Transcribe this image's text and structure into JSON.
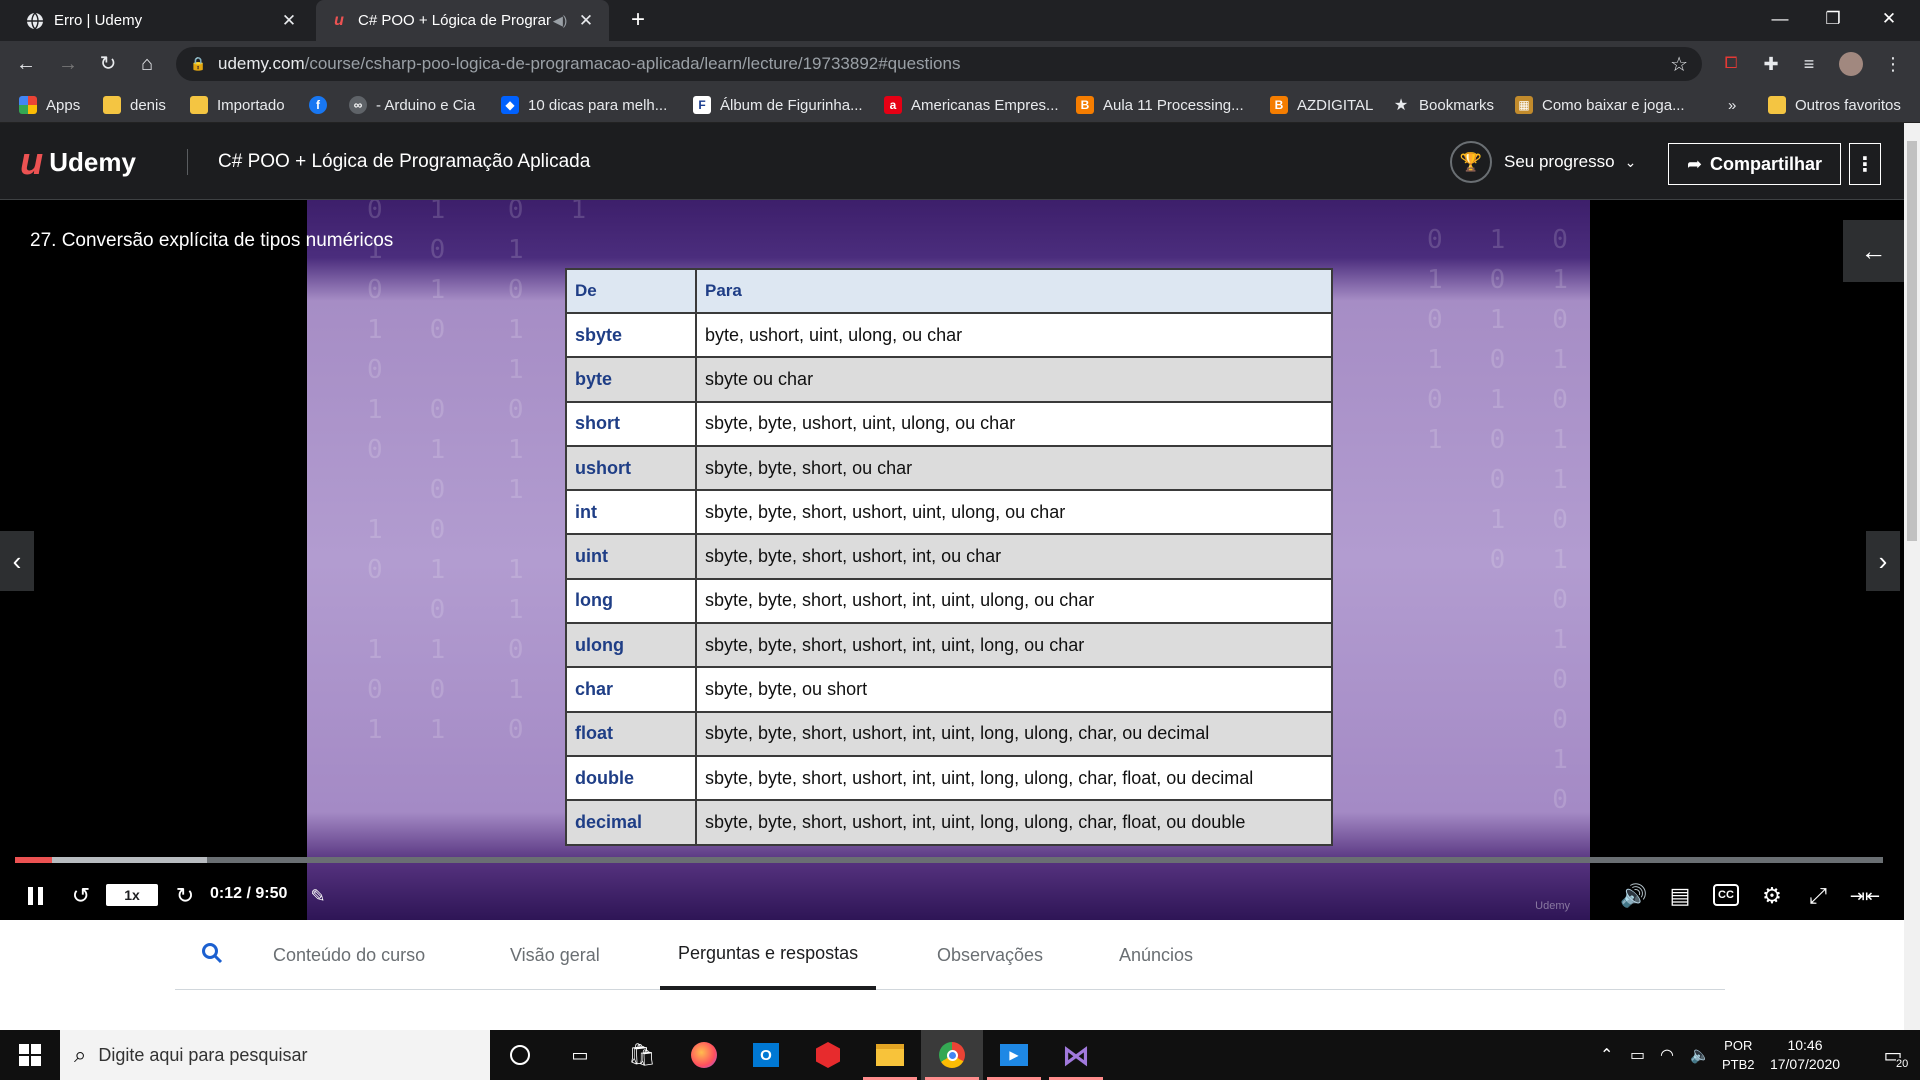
{
  "browser": {
    "tabs": [
      {
        "title": "Erro | Udemy",
        "icon": "globe-icon"
      },
      {
        "title": "C# POO + Lógica de Progran",
        "icon": "udemy-icon"
      }
    ],
    "url_host": "udemy.com",
    "url_path": "/course/csharp-poo-logica-de-programacao-aplicada/learn/lecture/19733892#questions",
    "bookmarks": [
      {
        "label": "Apps",
        "icon": "apps-grid-icon",
        "color": "#ea4335"
      },
      {
        "label": "denis",
        "icon": "folder-icon",
        "color": "#f4c542"
      },
      {
        "label": "Importado",
        "icon": "folder-icon",
        "color": "#f4c542"
      },
      {
        "label": "",
        "icon": "facebook-icon",
        "color": "#1877f2"
      },
      {
        "label": "- Arduino e Cia",
        "icon": "arduino-icon",
        "color": "#5f6368"
      },
      {
        "label": "10 dicas para melh...",
        "icon": "dropbox-icon",
        "color": "#0061fe"
      },
      {
        "label": "Álbum de Figurinha...",
        "icon": "f-icon",
        "color": "#1a3c8f"
      },
      {
        "label": "Americanas Empres...",
        "icon": "americanas-icon",
        "color": "#e60014"
      },
      {
        "label": "Aula 11 Processing...",
        "icon": "blogger-icon",
        "color": "#f57d00"
      },
      {
        "label": "AZDIGITAL",
        "icon": "blogger-icon",
        "color": "#f57d00"
      },
      {
        "label": "Bookmarks",
        "icon": "star-icon",
        "color": "#e8eaed"
      },
      {
        "label": "Como baixar e joga...",
        "icon": "game-icon",
        "color": "#c28b2c"
      },
      {
        "label": "Outros favoritos",
        "icon": "folder-icon",
        "color": "#f4c542"
      }
    ],
    "overflow": "»"
  },
  "udemy": {
    "logo": "Udemy",
    "course_title": "C# POO + Lógica de Programação Aplicada",
    "progress_label": "Seu progresso",
    "share_label": "Compartilhar"
  },
  "video": {
    "lecture_title": "27. Conversão explícita de tipos numéricos",
    "table_headers": [
      "De",
      "Para"
    ],
    "table_rows": [
      {
        "de": "sbyte",
        "para": "byte, ushort, uint, ulong, ou char"
      },
      {
        "de": "byte",
        "para": "sbyte ou char"
      },
      {
        "de": "short",
        "para": "sbyte, byte, ushort, uint, ulong, ou char"
      },
      {
        "de": "ushort",
        "para": "sbyte, byte, short, ou char"
      },
      {
        "de": "int",
        "para": "sbyte, byte, short, ushort, uint, ulong, ou char"
      },
      {
        "de": "uint",
        "para": "sbyte, byte, short, ushort, int, ou char"
      },
      {
        "de": "long",
        "para": "sbyte, byte, short, ushort, int, uint, ulong, ou char"
      },
      {
        "de": "ulong",
        "para": "sbyte, byte, short, ushort, int, uint, long, ou char"
      },
      {
        "de": "char",
        "para": "sbyte, byte, ou short"
      },
      {
        "de": "float",
        "para": "sbyte, byte, short, ushort, int, uint, long, ulong, char, ou decimal"
      },
      {
        "de": "double",
        "para": "sbyte, byte, short, ushort, int, uint, long, ulong, char, float, ou decimal"
      },
      {
        "de": "decimal",
        "para": "sbyte, byte, short, ushort, int, uint, long, ulong, char, float, ou double"
      }
    ],
    "watermark": "Udemy",
    "speed": "1x",
    "time": "0:12 / 9:50",
    "played_fraction": 0.02,
    "buffered_fraction": 0.103,
    "cc_label": "CC"
  },
  "page_tabs": [
    "Conteúdo do curso",
    "Visão geral",
    "Perguntas e respostas",
    "Observações",
    "Anúncios"
  ],
  "page_tabs_active": "Perguntas e respostas",
  "taskbar": {
    "search_placeholder": "Digite aqui para pesquisar",
    "lang_top": "POR",
    "lang_bottom": "PTB2",
    "time": "10:46",
    "date": "17/07/2020",
    "notifications": "20"
  }
}
